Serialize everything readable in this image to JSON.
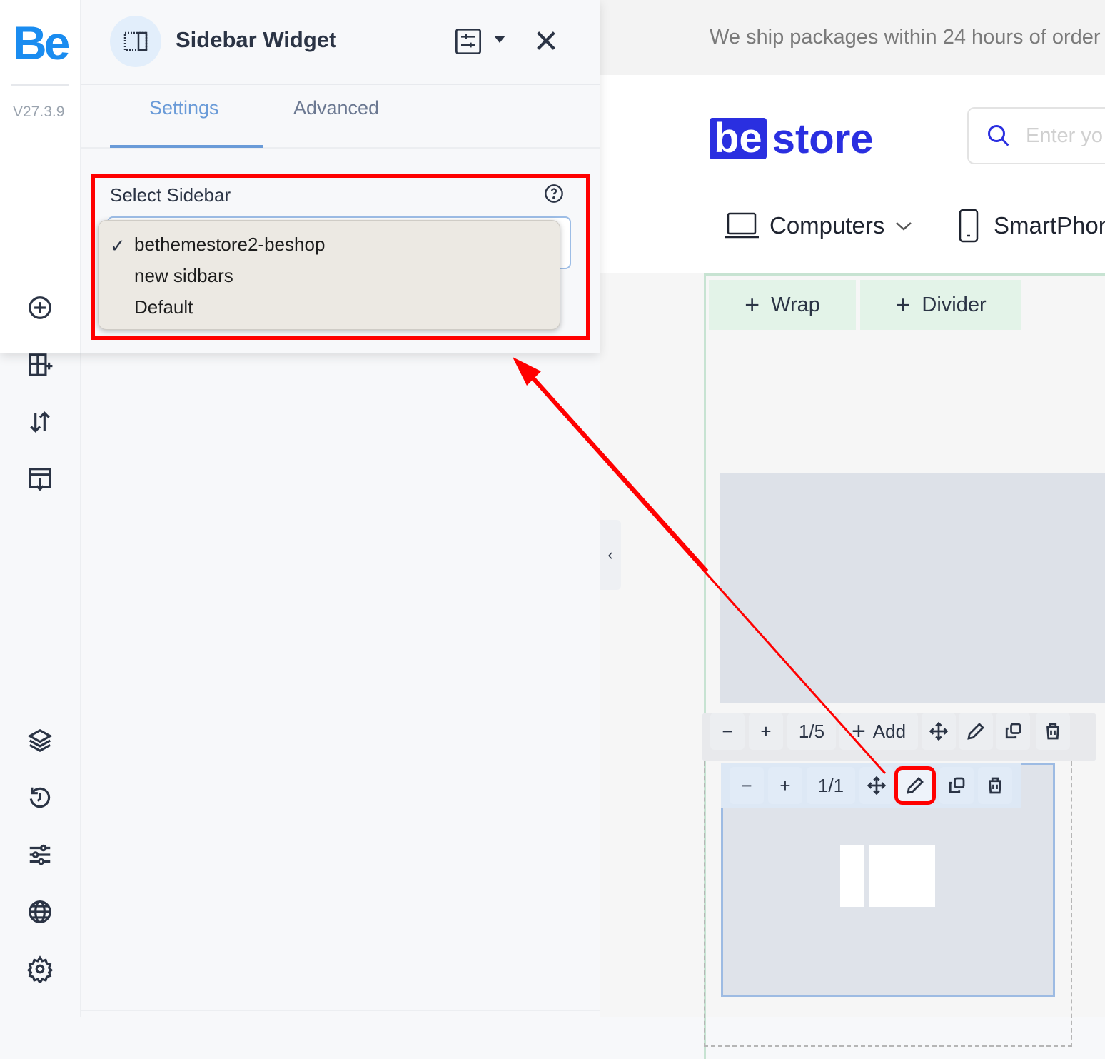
{
  "rail": {
    "logo": "Be",
    "version": "V27.3.9",
    "brand_color": "#1a8cf0",
    "icons": [
      "plus-circle-icon",
      "layout-add-icon",
      "sort-icon",
      "import-icon",
      "layers-icon",
      "history-icon",
      "sliders-icon",
      "globe-icon",
      "gear-icon"
    ]
  },
  "panel": {
    "title": "Sidebar Widget",
    "tabs": [
      {
        "label": "Settings",
        "active": true
      },
      {
        "label": "Advanced",
        "active": false
      }
    ],
    "field_label": "Select Sidebar",
    "dropdown": {
      "selected": "bethemestore2-beshop",
      "options": [
        "bethemestore2-beshop",
        "new sidbars",
        "Default"
      ],
      "check": "✓"
    }
  },
  "preview": {
    "shipping_text": "We ship packages within 24 hours of order",
    "logo_be": "be",
    "logo_store": "store",
    "logo_color": "#2a2fe0",
    "search_placeholder": "Enter yo",
    "nav": [
      {
        "label": "Computers",
        "icon": "laptop-icon"
      },
      {
        "label": "SmartPhon",
        "icon": "phone-icon"
      }
    ],
    "wrap_label": "Wrap",
    "divider_label": "Divider",
    "toolbar1": {
      "counter": "1/5",
      "add_label": "Add"
    },
    "toolbar2": {
      "counter": "1/1"
    }
  },
  "annotation_color": "#ff0000"
}
